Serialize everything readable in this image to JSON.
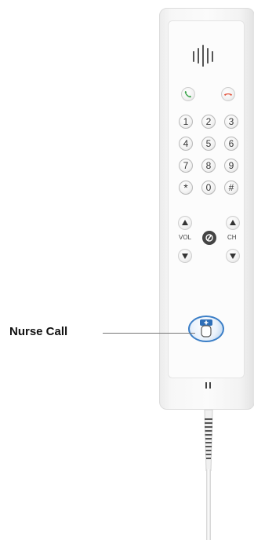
{
  "callout": {
    "label": "Nurse Call"
  },
  "handset": {
    "keypad": [
      "1",
      "2",
      "3",
      "4",
      "5",
      "6",
      "7",
      "8",
      "9",
      "*",
      "0",
      "#"
    ],
    "vol_label": "VOL",
    "ch_label": "CH",
    "icons": {
      "answer": "phone-answer-icon",
      "hangup": "phone-hangup-icon",
      "tv_power": "tv-power-icon",
      "nurse": "nurse-call-icon"
    }
  },
  "colors": {
    "answer": "#3aa34a",
    "hangup": "#e2533d",
    "nurse_button": "#3c7fc7",
    "leader_line": "#777777"
  }
}
